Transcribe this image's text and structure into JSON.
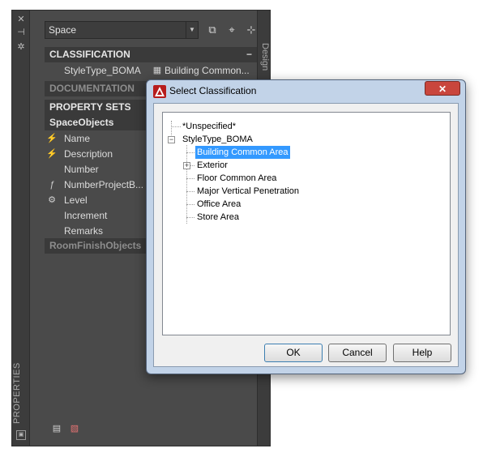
{
  "palette": {
    "style_value": "Space",
    "vertical_title": "PROPERTIES",
    "design_tab": "Design",
    "sections": {
      "classification": "CLASSIFICATION",
      "documentation": "DOCUMENTATION",
      "property_sets": "PROPERTY SETS",
      "space_objects": "SpaceObjects",
      "room_finish_objects": "RoomFinishObjects"
    },
    "classification_row": {
      "label": "StyleType_BOMA",
      "value": "Building  Common..."
    },
    "properties": [
      "Name",
      "Description",
      "Number",
      "NumberProjectB...",
      "Level",
      "Increment",
      "Remarks"
    ],
    "collapse_symbol": "−"
  },
  "dialog": {
    "title": "Select Classification",
    "close_label": "✕",
    "tree": {
      "unspecified": "*Unspecified*",
      "root": "StyleType_BOMA",
      "children": [
        "Building Common Area",
        "Exterior",
        "Floor Common Area",
        "Major Vertical Penetration",
        "Office Area",
        "Store Area"
      ],
      "selected_index": 0
    },
    "buttons": {
      "ok": "OK",
      "cancel": "Cancel",
      "help": "Help"
    }
  },
  "colors": {
    "palette_bg": "#4a4a4a",
    "dialog_frame": "#c2d3e8",
    "selection": "#3399ff",
    "close": "#c9463d"
  }
}
